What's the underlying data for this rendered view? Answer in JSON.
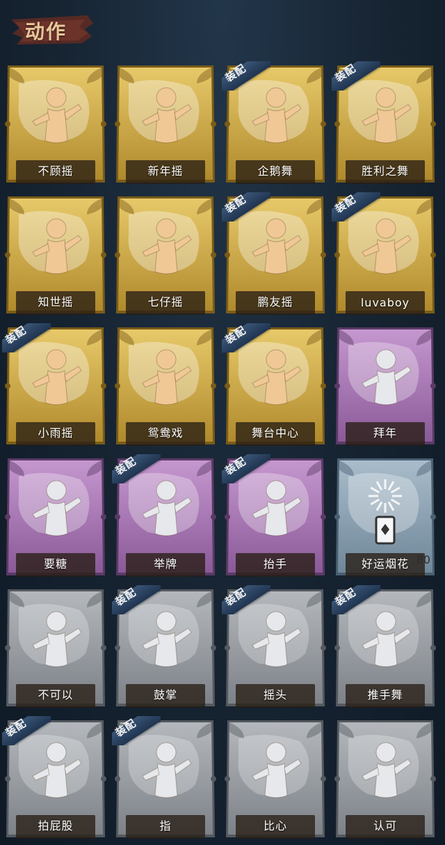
{
  "header": {
    "title": "动作"
  },
  "badge_label": "装配",
  "colors": {
    "gold": "#c9a646",
    "purple": "#9b6aa6",
    "blue": "#7d93a6",
    "gray": "#8a8f96",
    "figure_gold": "#f0c896",
    "figure_silver": "#e6e8ec"
  },
  "cards": [
    {
      "name": "不顾摇",
      "rarity": "gold",
      "equipped": false,
      "icon": "dance-pose-icon"
    },
    {
      "name": "新年摇",
      "rarity": "gold",
      "equipped": false,
      "icon": "dance-pose-icon"
    },
    {
      "name": "企鹅舞",
      "rarity": "gold",
      "equipped": true,
      "icon": "dance-pose-icon"
    },
    {
      "name": "胜利之舞",
      "rarity": "gold",
      "equipped": true,
      "icon": "dance-pose-icon"
    },
    {
      "name": "知世摇",
      "rarity": "gold",
      "equipped": false,
      "icon": "dance-pose-icon"
    },
    {
      "name": "七仔摇",
      "rarity": "gold",
      "equipped": false,
      "icon": "dance-pose-icon"
    },
    {
      "name": "鹏友摇",
      "rarity": "gold",
      "equipped": true,
      "icon": "dance-pose-icon"
    },
    {
      "name": "luvaboy",
      "rarity": "gold",
      "equipped": true,
      "icon": "dance-pose-icon"
    },
    {
      "name": "小雨摇",
      "rarity": "gold",
      "equipped": true,
      "icon": "dance-pose-icon"
    },
    {
      "name": "鸳鸯戏",
      "rarity": "gold",
      "equipped": false,
      "icon": "dance-pose-icon"
    },
    {
      "name": "舞台中心",
      "rarity": "gold",
      "equipped": true,
      "icon": "dance-pose-icon"
    },
    {
      "name": "拜年",
      "rarity": "purple",
      "equipped": false,
      "icon": "bow-pose-icon"
    },
    {
      "name": "要糖",
      "rarity": "purple",
      "equipped": false,
      "icon": "reach-pose-icon"
    },
    {
      "name": "举牌",
      "rarity": "purple",
      "equipped": true,
      "icon": "sign-board-icon"
    },
    {
      "name": "抬手",
      "rarity": "purple",
      "equipped": true,
      "icon": "raise-hand-icon"
    },
    {
      "name": "好运烟花",
      "rarity": "blue",
      "equipped": false,
      "icon": "firework-icon",
      "count": "80"
    },
    {
      "name": "不可以",
      "rarity": "gray",
      "equipped": false,
      "icon": "finger-wag-icon"
    },
    {
      "name": "鼓掌",
      "rarity": "gray",
      "equipped": true,
      "icon": "clap-icon"
    },
    {
      "name": "摇头",
      "rarity": "gray",
      "equipped": true,
      "icon": "shake-head-icon"
    },
    {
      "name": "推手舞",
      "rarity": "gray",
      "equipped": true,
      "icon": "push-dance-icon"
    },
    {
      "name": "拍屁股",
      "rarity": "gray",
      "equipped": true,
      "icon": "pat-butt-icon"
    },
    {
      "name": "指",
      "rarity": "gray",
      "equipped": true,
      "icon": "point-hand-icon"
    },
    {
      "name": "比心",
      "rarity": "gray",
      "equipped": false,
      "icon": "finger-heart-icon"
    },
    {
      "name": "认可",
      "rarity": "gray",
      "equipped": false,
      "icon": "thumbs-up-icon"
    }
  ]
}
